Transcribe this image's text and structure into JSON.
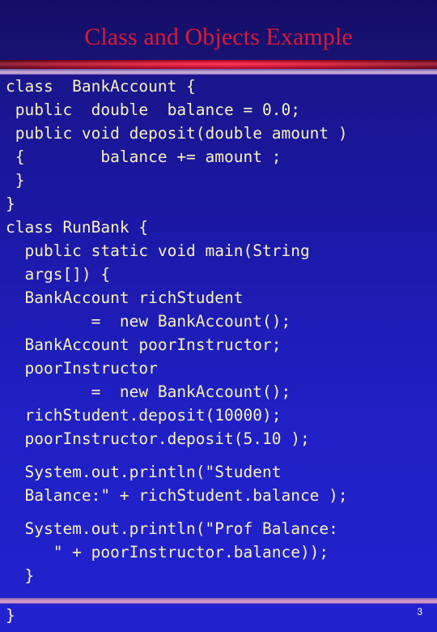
{
  "slide": {
    "title": "Class and Objects Example",
    "page_number": "3",
    "title_color": "#d81a36",
    "code_color": "#f7f2c0",
    "background_color": "#2020c4",
    "header_color": "#16106e",
    "accent_bar_color": "#ff0a36",
    "divider_bar_color": "#c8a9d6"
  },
  "code": {
    "lines": [
      {
        "text": "class  BankAccount {",
        "gap": false
      },
      {
        "text": " public  double  balance = 0.0;",
        "gap": false
      },
      {
        "text": " public void deposit(double amount )",
        "gap": false
      },
      {
        "text": " {        balance += amount ;",
        "gap": false
      },
      {
        "text": " }",
        "gap": false
      },
      {
        "text": "}",
        "gap": false
      },
      {
        "text": "class RunBank {",
        "gap": false
      },
      {
        "text": "  public static void main(String",
        "gap": false
      },
      {
        "text": "  args[]) {",
        "gap": false
      },
      {
        "text": "  BankAccount richStudent",
        "gap": false
      },
      {
        "text": "         =  new BankAccount();",
        "gap": false
      },
      {
        "text": "  BankAccount poorInstructor;",
        "gap": false
      },
      {
        "text": "  poorInstructor",
        "gap": false
      },
      {
        "text": "         =  new BankAccount();",
        "gap": false
      },
      {
        "text": "  richStudent.deposit(10000);",
        "gap": false
      },
      {
        "text": "  poorInstructor.deposit(5.10 );",
        "gap": false
      },
      {
        "text": "  System.out.println(\"Student",
        "gap": true
      },
      {
        "text": "  Balance:\" + richStudent.balance );",
        "gap": false
      },
      {
        "text": "  System.out.println(\"Prof Balance:",
        "gap": true
      },
      {
        "text": "     \" + poorInstructor.balance));",
        "gap": false
      },
      {
        "text": "  }",
        "gap": false
      }
    ],
    "footer_line": "}"
  }
}
